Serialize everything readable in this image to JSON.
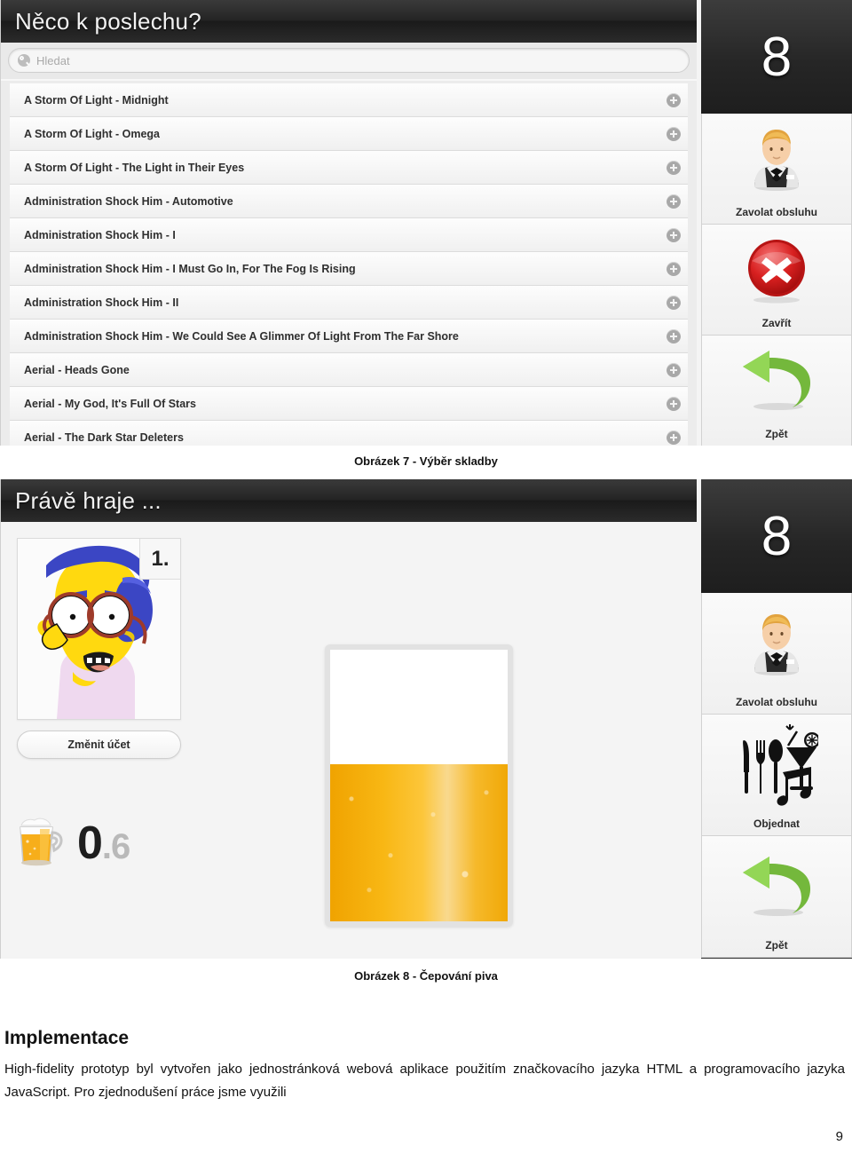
{
  "figure7": {
    "caption": "Obrázek 7 - Výběr skladby",
    "header_title": "Něco k poslechu?",
    "search": {
      "placeholder": "Hledat",
      "icon": "search-icon"
    },
    "songs": [
      "A Storm Of Light - Midnight",
      "A Storm Of Light - Omega",
      "A Storm Of Light - The Light in Their Eyes",
      "Administration Shock Him - Automotive",
      "Administration Shock Him - I",
      "Administration Shock Him - I Must Go In, For The Fog Is Rising",
      "Administration Shock Him - II",
      "Administration Shock Him - We Could See A Glimmer Of Light From The Far Shore",
      "Aerial - Heads Gone",
      "Aerial - My God, It's Full Of Stars",
      "Aerial - The Dark Star Deleters"
    ],
    "add_icon": "plus-circle-icon",
    "sidebar": {
      "table_number": "8",
      "buttons": [
        {
          "label": "Zavolat obsluhu",
          "icon": "waiter-icon"
        },
        {
          "label": "Zavřít",
          "icon": "red-x-circle-icon"
        },
        {
          "label": "Zpět",
          "icon": "green-back-arrow-icon"
        }
      ]
    }
  },
  "figure8": {
    "caption": "Obrázek 8 - Čepování piva",
    "header_title": "Právě hraje ...",
    "account": {
      "badge": "1.",
      "avatar_icon": "user-avatar-milhouse",
      "change_account_label": "Změnit účet"
    },
    "beer_counter": {
      "icon": "beer-mug-icon",
      "whole": "0",
      "fraction": ".6"
    },
    "beer_glass": {
      "icon": "beer-glass-fill-indicator",
      "fill_percent": 58
    },
    "sidebar": {
      "table_number": "8",
      "buttons": [
        {
          "label": "Zavolat obsluhu",
          "icon": "waiter-icon"
        },
        {
          "label": "Objednat",
          "icon": "cutlery-cocktail-music-icon"
        },
        {
          "label": "Zpět",
          "icon": "green-back-arrow-icon"
        }
      ]
    }
  },
  "document": {
    "heading": "Implementace",
    "paragraph": "High-fidelity prototyp byl vytvořen jako jednostránková webová aplikace použitím značkovacího jazyka HTML a programovacího jazyka JavaScript. Pro zjednodušení práce jsme využili",
    "page_number": "9"
  },
  "colors": {
    "dark_bar": "#242424",
    "page_bg": "#ffffff",
    "beer": "#f8b714",
    "accent_green": "#7ac043",
    "accent_red": "#d32020"
  }
}
